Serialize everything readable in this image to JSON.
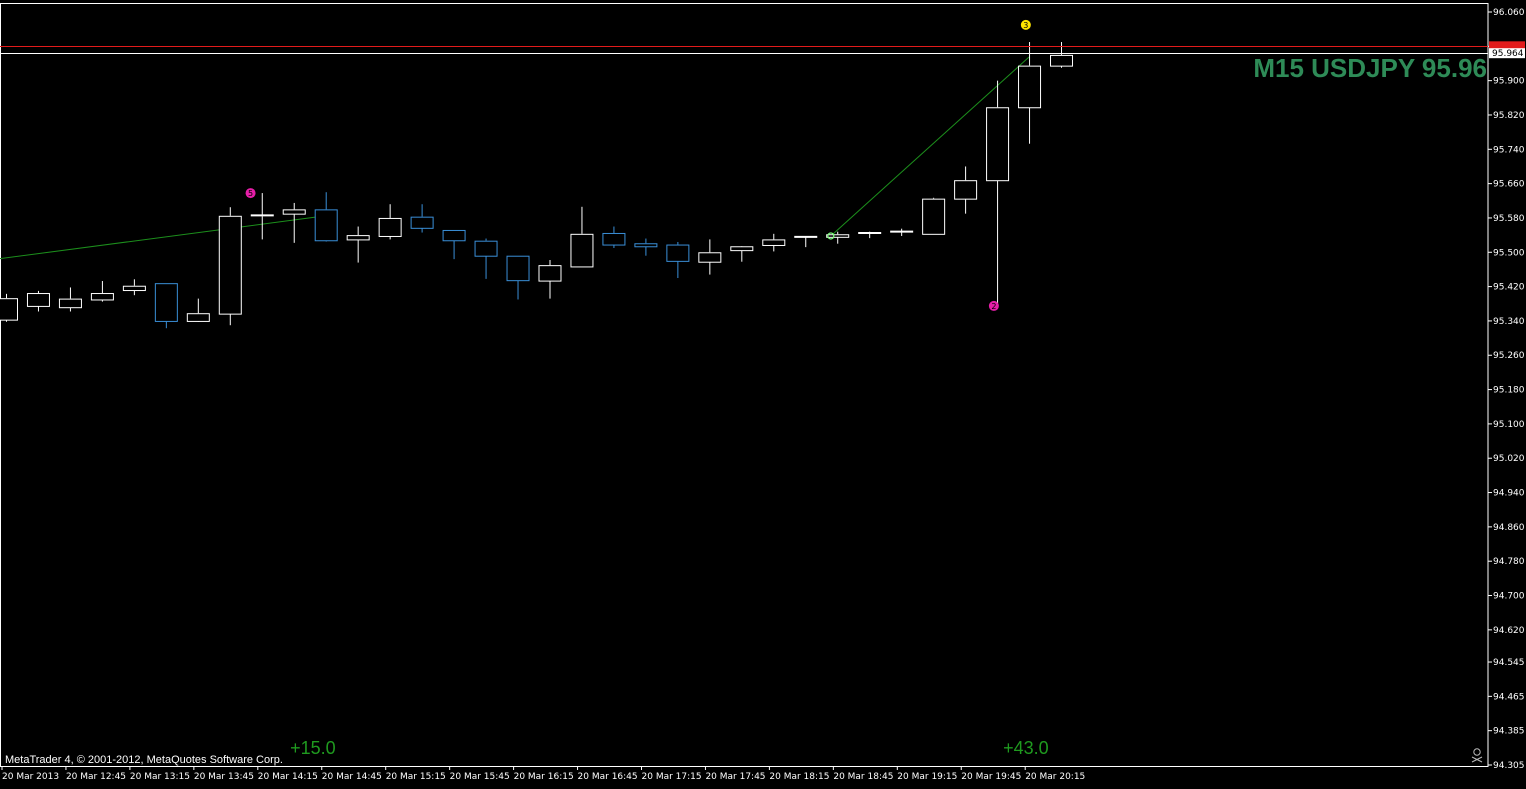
{
  "chart_header": "M15 USDJPY 95.96",
  "copyright": "MetaTrader 4, © 2001-2012, MetaQuotes Software Corp.",
  "current_price_label": "95.964",
  "icons": {
    "corner": "skull-crossbones-icon"
  },
  "colors": {
    "background": "#000000",
    "bull_candle": "#ffffff",
    "bear_candle": "#3a8fd8",
    "bid_line": "#ffffff",
    "ask_line": "#e21b1b",
    "trend_line": "#1c8f1c",
    "marker_magenta": "#e61ea8",
    "marker_yellow": "#ffe600",
    "pip_text": "#1f9a1f",
    "header_text": "#2e8b57"
  },
  "chart_data": {
    "type": "candlestick",
    "title": "M15 USDJPY 95.96",
    "symbol": "USDJPY",
    "timeframe": "M15",
    "ylim": [
      94.305,
      96.06
    ],
    "y_ticks": [
      "96.060",
      "95.980",
      "95.900",
      "95.820",
      "95.740",
      "95.660",
      "95.580",
      "95.500",
      "95.420",
      "95.340",
      "95.260",
      "95.180",
      "95.100",
      "95.020",
      "94.940",
      "94.860",
      "94.780",
      "94.700",
      "94.620",
      "94.545",
      "94.465",
      "94.385",
      "94.305"
    ],
    "x_ticks": [
      "20 Mar 2013",
      "20 Mar 12:45",
      "20 Mar 13:15",
      "20 Mar 13:45",
      "20 Mar 14:15",
      "20 Mar 14:45",
      "20 Mar 15:15",
      "20 Mar 15:45",
      "20 Mar 16:15",
      "20 Mar 16:45",
      "20 Mar 17:15",
      "20 Mar 17:45",
      "20 Mar 18:15",
      "20 Mar 18:45",
      "20 Mar 19:15",
      "20 Mar 19:45",
      "20 Mar 20:15"
    ],
    "bid": 95.964,
    "ask": 95.98,
    "candles": [
      {
        "o": 95.343,
        "h": 95.403,
        "l": 95.338,
        "c": 95.393
      },
      {
        "o": 95.375,
        "h": 95.41,
        "l": 95.362,
        "c": 95.405
      },
      {
        "o": 95.372,
        "h": 95.418,
        "l": 95.362,
        "c": 95.392
      },
      {
        "o": 95.39,
        "h": 95.433,
        "l": 95.385,
        "c": 95.405
      },
      {
        "o": 95.412,
        "h": 95.437,
        "l": 95.4,
        "c": 95.422
      },
      {
        "o": 95.428,
        "h": 95.428,
        "l": 95.323,
        "c": 95.34
      },
      {
        "o": 95.34,
        "h": 95.392,
        "l": 95.338,
        "c": 95.358
      },
      {
        "o": 95.357,
        "h": 95.605,
        "l": 95.33,
        "c": 95.585
      },
      {
        "o": 95.584,
        "h": 95.638,
        "l": 95.53,
        "c": 95.586
      },
      {
        "o": 95.59,
        "h": 95.615,
        "l": 95.522,
        "c": 95.6
      },
      {
        "o": 95.6,
        "h": 95.64,
        "l": 95.525,
        "c": 95.528
      },
      {
        "o": 95.53,
        "h": 95.56,
        "l": 95.476,
        "c": 95.54
      },
      {
        "o": 95.538,
        "h": 95.612,
        "l": 95.53,
        "c": 95.58
      },
      {
        "o": 95.583,
        "h": 95.612,
        "l": 95.546,
        "c": 95.557
      },
      {
        "o": 95.552,
        "h": 95.552,
        "l": 95.484,
        "c": 95.528
      },
      {
        "o": 95.527,
        "h": 95.532,
        "l": 95.438,
        "c": 95.492
      },
      {
        "o": 95.492,
        "h": 95.492,
        "l": 95.39,
        "c": 95.435
      },
      {
        "o": 95.434,
        "h": 95.482,
        "l": 95.392,
        "c": 95.47
      },
      {
        "o": 95.467,
        "h": 95.606,
        "l": 95.467,
        "c": 95.543
      },
      {
        "o": 95.545,
        "h": 95.56,
        "l": 95.51,
        "c": 95.518
      },
      {
        "o": 95.521,
        "h": 95.532,
        "l": 95.492,
        "c": 95.514
      },
      {
        "o": 95.518,
        "h": 95.524,
        "l": 95.44,
        "c": 95.48
      },
      {
        "o": 95.478,
        "h": 95.53,
        "l": 95.448,
        "c": 95.5
      },
      {
        "o": 95.505,
        "h": 95.512,
        "l": 95.478,
        "c": 95.514
      },
      {
        "o": 95.517,
        "h": 95.543,
        "l": 95.502,
        "c": 95.53
      },
      {
        "o": 95.535,
        "h": 95.535,
        "l": 95.512,
        "c": 95.536
      },
      {
        "o": 95.536,
        "h": 95.548,
        "l": 95.52,
        "c": 95.542
      },
      {
        "o": 95.543,
        "h": 95.548,
        "l": 95.533,
        "c": 95.545
      },
      {
        "o": 95.546,
        "h": 95.555,
        "l": 95.538,
        "c": 95.548
      },
      {
        "o": 95.543,
        "h": 95.627,
        "l": 95.543,
        "c": 95.625
      },
      {
        "o": 95.625,
        "h": 95.7,
        "l": 95.59,
        "c": 95.668
      },
      {
        "o": 95.668,
        "h": 95.9,
        "l": 95.378,
        "c": 95.838
      },
      {
        "o": 95.838,
        "h": 95.99,
        "l": 95.753,
        "c": 95.935
      },
      {
        "o": 95.935,
        "h": 95.99,
        "l": 95.93,
        "c": 95.96
      }
    ],
    "trend_lines": [
      {
        "from": {
          "bar": -0.2,
          "price": 95.485
        },
        "to": {
          "bar": 10.0,
          "price": 95.585
        }
      },
      {
        "from": {
          "bar": 25.8,
          "price": 95.538
        },
        "to": {
          "bar": 32.0,
          "price": 95.955
        }
      }
    ],
    "markers": [
      {
        "bar": 7.65,
        "price": 95.638,
        "color": "magenta",
        "label": "5"
      },
      {
        "bar": 30.9,
        "price": 95.375,
        "color": "magenta",
        "label": "2"
      },
      {
        "bar": 31.9,
        "price": 96.03,
        "color": "yellow",
        "label": "3"
      },
      {
        "bar": 25.8,
        "price": 95.538,
        "color": "green",
        "label": ""
      }
    ],
    "annotations": [
      {
        "text": "+15.0",
        "bar": 9.6
      },
      {
        "text": "+43.0",
        "bar": 31.9
      }
    ]
  }
}
